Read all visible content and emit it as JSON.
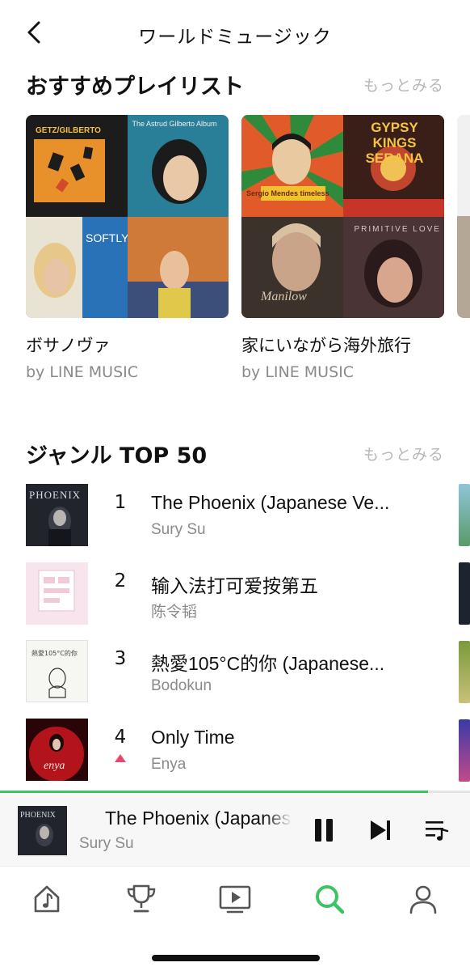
{
  "header": {
    "title": "ワールドミュージック",
    "back_icon": "chevron-left-icon"
  },
  "playlists_section": {
    "title": "おすすめプレイリスト",
    "more": "もっとみる",
    "items": [
      {
        "name": "ボサノヴァ",
        "by": "by LINE MUSIC",
        "tiles": [
          {
            "text": "GETZ/GILBERTO",
            "bg": "#1c1c1c",
            "accent": "#e8902a"
          },
          {
            "text": "The Astrud Gilberto Album",
            "bg": "#1f6e8a",
            "accent": "#f0f0f0"
          },
          {
            "text": "SOFTLY",
            "bg": "#2a72b8",
            "accent": "#ffffff"
          },
          {
            "text": "",
            "bg": "#c45a2a",
            "accent": "#e8b84a"
          }
        ]
      },
      {
        "name": "家にいながら海外旅行",
        "by": "by LINE MUSIC",
        "tiles": [
          {
            "text": "Sergio Mendes timeless",
            "bg": "#d7562a",
            "accent": "#f2c12e"
          },
          {
            "text": "GYPSY KINGS SERANA",
            "bg": "#2c1a14",
            "accent": "#f5c445"
          },
          {
            "text": "Manilow",
            "bg": "#2d2622",
            "accent": "#c9b8a0"
          },
          {
            "text": "PRIMITIVE LOVE",
            "bg": "#3a2a2c",
            "accent": "#b9a6a8"
          }
        ]
      }
    ]
  },
  "ranking_section": {
    "title": "ジャンル TOP 50",
    "more": "もっとみる",
    "items": [
      {
        "rank": "1",
        "title": "The Phoenix (Japanese Ve...",
        "artist": "Sury Su",
        "art_bg": "#22242c",
        "up": false
      },
      {
        "rank": "2",
        "title": "输入法打可爱按第五",
        "artist": "陈令韬",
        "art_bg": "#f6dde6",
        "up": false
      },
      {
        "rank": "3",
        "title": "熱愛105°C的你 (Japanese...",
        "artist": "Bodokun",
        "art_bg": "#f4f4f1",
        "up": false
      },
      {
        "rank": "4",
        "title": "Only Time",
        "artist": "Enya",
        "art_bg": "#b3141c",
        "up": true
      }
    ]
  },
  "mini_player": {
    "title": "The Phoenix (Japanese Ver.)",
    "artist": "Sury Su",
    "progress": 0.91,
    "progress_color": "#3cc463",
    "controls": [
      "pause-icon",
      "skip-next-icon",
      "queue-icon"
    ]
  },
  "tabbar": {
    "tabs": [
      {
        "icon": "music-note-icon",
        "active": false
      },
      {
        "icon": "trophy-icon",
        "active": false
      },
      {
        "icon": "video-play-icon",
        "active": false
      },
      {
        "icon": "search-icon",
        "active": true
      },
      {
        "icon": "user-icon",
        "active": false
      }
    ],
    "active_color": "#3cc463"
  }
}
